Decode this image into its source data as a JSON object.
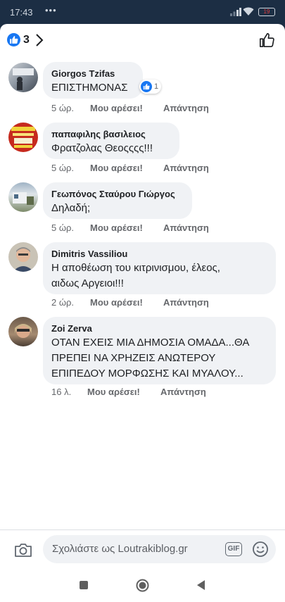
{
  "status": {
    "time": "17:43",
    "dots": "•••",
    "battery": "19"
  },
  "header": {
    "reaction_count": "3"
  },
  "comments": [
    {
      "author": "Giorgos Tzifas",
      "text": [
        "ΕΠΙΣΤΗΜΟΝΑΣ"
      ],
      "time": "5 ώρ.",
      "like": "Μου αρέσει!",
      "reply": "Απάντηση",
      "reactions": "1"
    },
    {
      "author": "παπαφιλης βασιλειος",
      "text": [
        "Φρατζολας Θεοςςςς!!!"
      ],
      "time": "5 ώρ.",
      "like": "Μου αρέσει!",
      "reply": "Απάντηση"
    },
    {
      "author": "Γεωπόνος Σταύρου Γιώργος",
      "text": [
        "Δηλαδή;"
      ],
      "time": "5 ώρ.",
      "like": "Μου αρέσει!",
      "reply": "Απάντηση"
    },
    {
      "author": "Dimitris Vassiliou",
      "text": [
        "Η αποθέωση του κιτρινισμου, έλεος,",
        "αιδως Αργειοι!!!"
      ],
      "time": "2 ώρ.",
      "like": "Μου αρέσει!",
      "reply": "Απάντηση"
    },
    {
      "author": "Zoi Zerva",
      "text": [
        "ΟΤΑΝ ΕΧΕΙΣ ΜΙΑ ΔΗΜΟΣΙΑ ΟΜΑΔΑ...ΘΑ",
        "ΠΡΕΠΕΙ ΝΑ ΧΡΗΖΕΙΣ ΑΝΩΤΕΡΟΥ",
        "ΕΠΙΠΕΔΟΥ ΜΟΡΦΩΣΗΣ ΚΑΙ ΜΥΑΛΟΥ..."
      ],
      "time": "16 λ.",
      "like": "Μου αρέσει!",
      "reply": "Απάντηση"
    }
  ],
  "composer": {
    "placeholder": "Σχολιάστε ως Loutrakiblog.gr",
    "gif_label": "GIF"
  },
  "colors": {
    "accent": "#1877f2",
    "bubble": "#f0f2f5",
    "meta": "#65676b"
  },
  "icons": {
    "camera": "camera-icon",
    "emoji": "emoji-icon",
    "like": "thumbs-up-icon"
  }
}
